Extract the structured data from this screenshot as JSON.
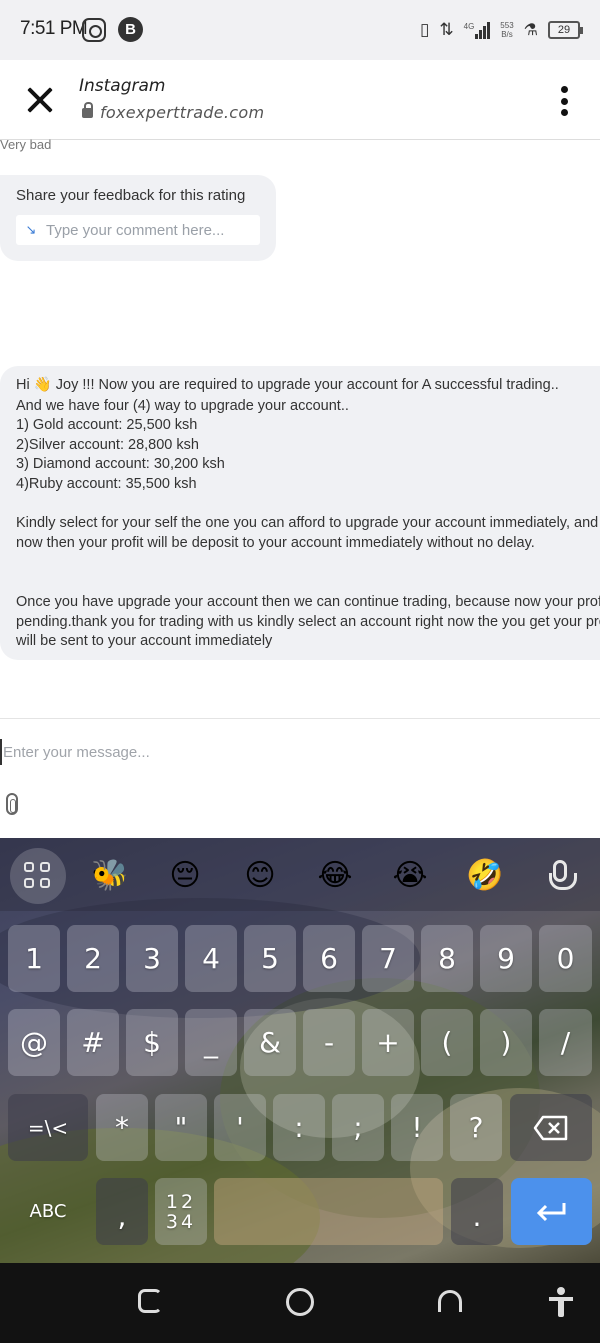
{
  "status_bar": {
    "time": "7:51 PM",
    "network_label": "4G",
    "speed_value": "553",
    "speed_unit": "B/s",
    "battery_level": "29"
  },
  "browser": {
    "title": "Instagram",
    "url": "foxexperttrade.com"
  },
  "chat": {
    "rating_label": "Very bad",
    "feedback_prompt": "Share your feedback for this rating",
    "comment_placeholder": "Type your comment here...",
    "message_lines": [
      "Hi 👋 Joy !!! Now you are required to upgrade your account for A successful trading..",
      "And we have four (4) way to upgrade your account..",
      "1) Gold account: 25,500 ksh",
      "2)Silver account: 28,800 ksh",
      "3) Diamond account: 30,200 ksh",
      "4)Ruby account: 35,500 ksh",
      "Kindly select for your self the one you can afford to upgrade your account immediately, and",
      "now then your profit will be deposit to your account immediately without no delay.",
      "Once you have upgrade your account then we can continue trading, because now your profit is",
      "pending.thank you for trading with us kindly select an account right now the you get your profit",
      "will be sent to your account immediately"
    ]
  },
  "composer": {
    "placeholder": "Enter your message..."
  },
  "keyboard": {
    "emoji_row": [
      "🐝",
      "😔",
      "😊",
      "😂",
      "😭",
      "🤣"
    ],
    "row1": [
      "1",
      "2",
      "3",
      "4",
      "5",
      "6",
      "7",
      "8",
      "9",
      "0"
    ],
    "row2": [
      "@",
      "#",
      "$",
      "_",
      "&",
      "-",
      "+",
      "(",
      ")",
      "/"
    ],
    "row3": [
      "=\\<",
      "*",
      "\"",
      "'",
      ":",
      ";",
      "!",
      "?"
    ],
    "abc_label": "ABC",
    "comma": ",",
    "numpad_top": "12",
    "numpad_bottom": "34",
    "period": "."
  }
}
